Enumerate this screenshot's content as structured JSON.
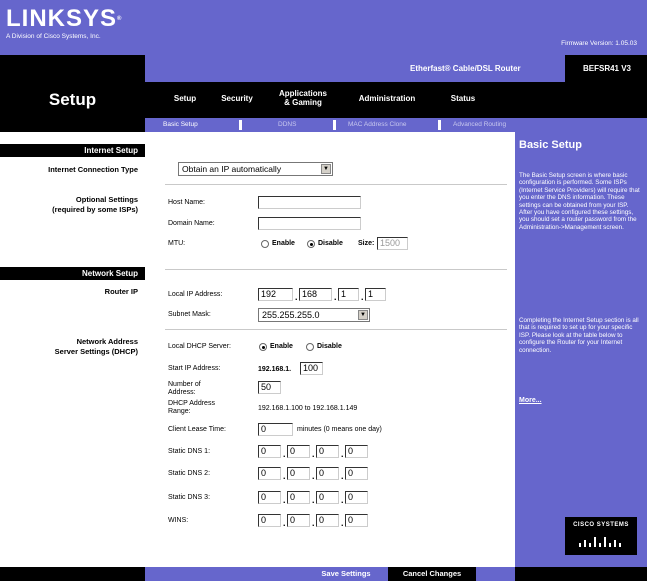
{
  "header": {
    "brand": "LINKSYS",
    "brand_mark": "®",
    "tagline": "A Division of Cisco Systems, Inc.",
    "firmware": "Firmware Version: 1.05.03"
  },
  "product": {
    "name": "Etherfast® Cable/DSL Router",
    "model": "BEFSR41 V3"
  },
  "section_title": "Setup",
  "nav": {
    "tabs": [
      {
        "label": "Setup",
        "active": true
      },
      {
        "label": "Security"
      },
      {
        "label": "Applications\n& Gaming"
      },
      {
        "label": "Administration"
      },
      {
        "label": "Status"
      }
    ],
    "subtabs": [
      {
        "label": "Basic Setup",
        "active": true
      },
      {
        "label": "DDNS"
      },
      {
        "label": "MAC Address Clone"
      },
      {
        "label": "Advanced Routing"
      }
    ]
  },
  "left": {
    "internet_setup": "Internet Setup",
    "connection_type": "Internet Connection Type",
    "optional_settings_1": "Optional Settings",
    "optional_settings_2": "(required by some ISPs)",
    "network_setup": "Network Setup",
    "router_ip": "Router IP",
    "dhcp_1": "Network Address",
    "dhcp_2": "Server Settings (DHCP)"
  },
  "form": {
    "connection_select": "Obtain an IP automatically",
    "host_name_label": "Host Name:",
    "host_name_value": "",
    "domain_name_label": "Domain Name:",
    "domain_name_value": "",
    "mtu_label": "MTU:",
    "mtu_enable": "Enable",
    "mtu_disable": "Disable",
    "mtu_size_label": "Size:",
    "mtu_size_value": "1500",
    "local_ip_label": "Local IP Address:",
    "local_ip": [
      "192",
      "168",
      "1",
      "1"
    ],
    "subnet_label": "Subnet Mask:",
    "subnet_value": "255.255.255.0",
    "dhcp_server_label": "Local DHCP Server:",
    "dhcp_enable": "Enable",
    "dhcp_disable": "Disable",
    "start_ip_label": "Start IP Address:",
    "start_ip_prefix": "192.168.1.",
    "start_ip_value": "100",
    "num_addr_label_1": "Number of",
    "num_addr_label_2": "Address:",
    "num_addr_value": "50",
    "range_label_1": "DHCP Address",
    "range_label_2": "Range:",
    "range_value": "192.168.1.100  to  192.168.1.149",
    "lease_label": "Client Lease Time:",
    "lease_value": "0",
    "lease_hint": "minutes (0 means one day)",
    "dns1_label": "Static DNS 1:",
    "dns2_label": "Static DNS 2:",
    "dns3_label": "Static DNS 3:",
    "wins_label": "WINS:",
    "zero": "0"
  },
  "help": {
    "title": "Basic Setup",
    "p1": "The Basic Setup screen is where basic configuration is performed. Some ISPs (Internet Service Providers) will require that you enter the DNS information. These settings can be obtained from your ISP. After you have configured these settings, you should set a router password from the Administration->Management screen.",
    "p2": "Completing the Internet Setup section is all that is required to set up for your specific ISP. Please look at the table below to configure the Router for your Internet connection.",
    "more": "More...",
    "cisco": "CISCO SYSTEMS"
  },
  "buttons": {
    "save": "Save Settings",
    "cancel": "Cancel Changes"
  },
  "colors": {
    "purple": "#6666cc",
    "black": "#000000"
  }
}
